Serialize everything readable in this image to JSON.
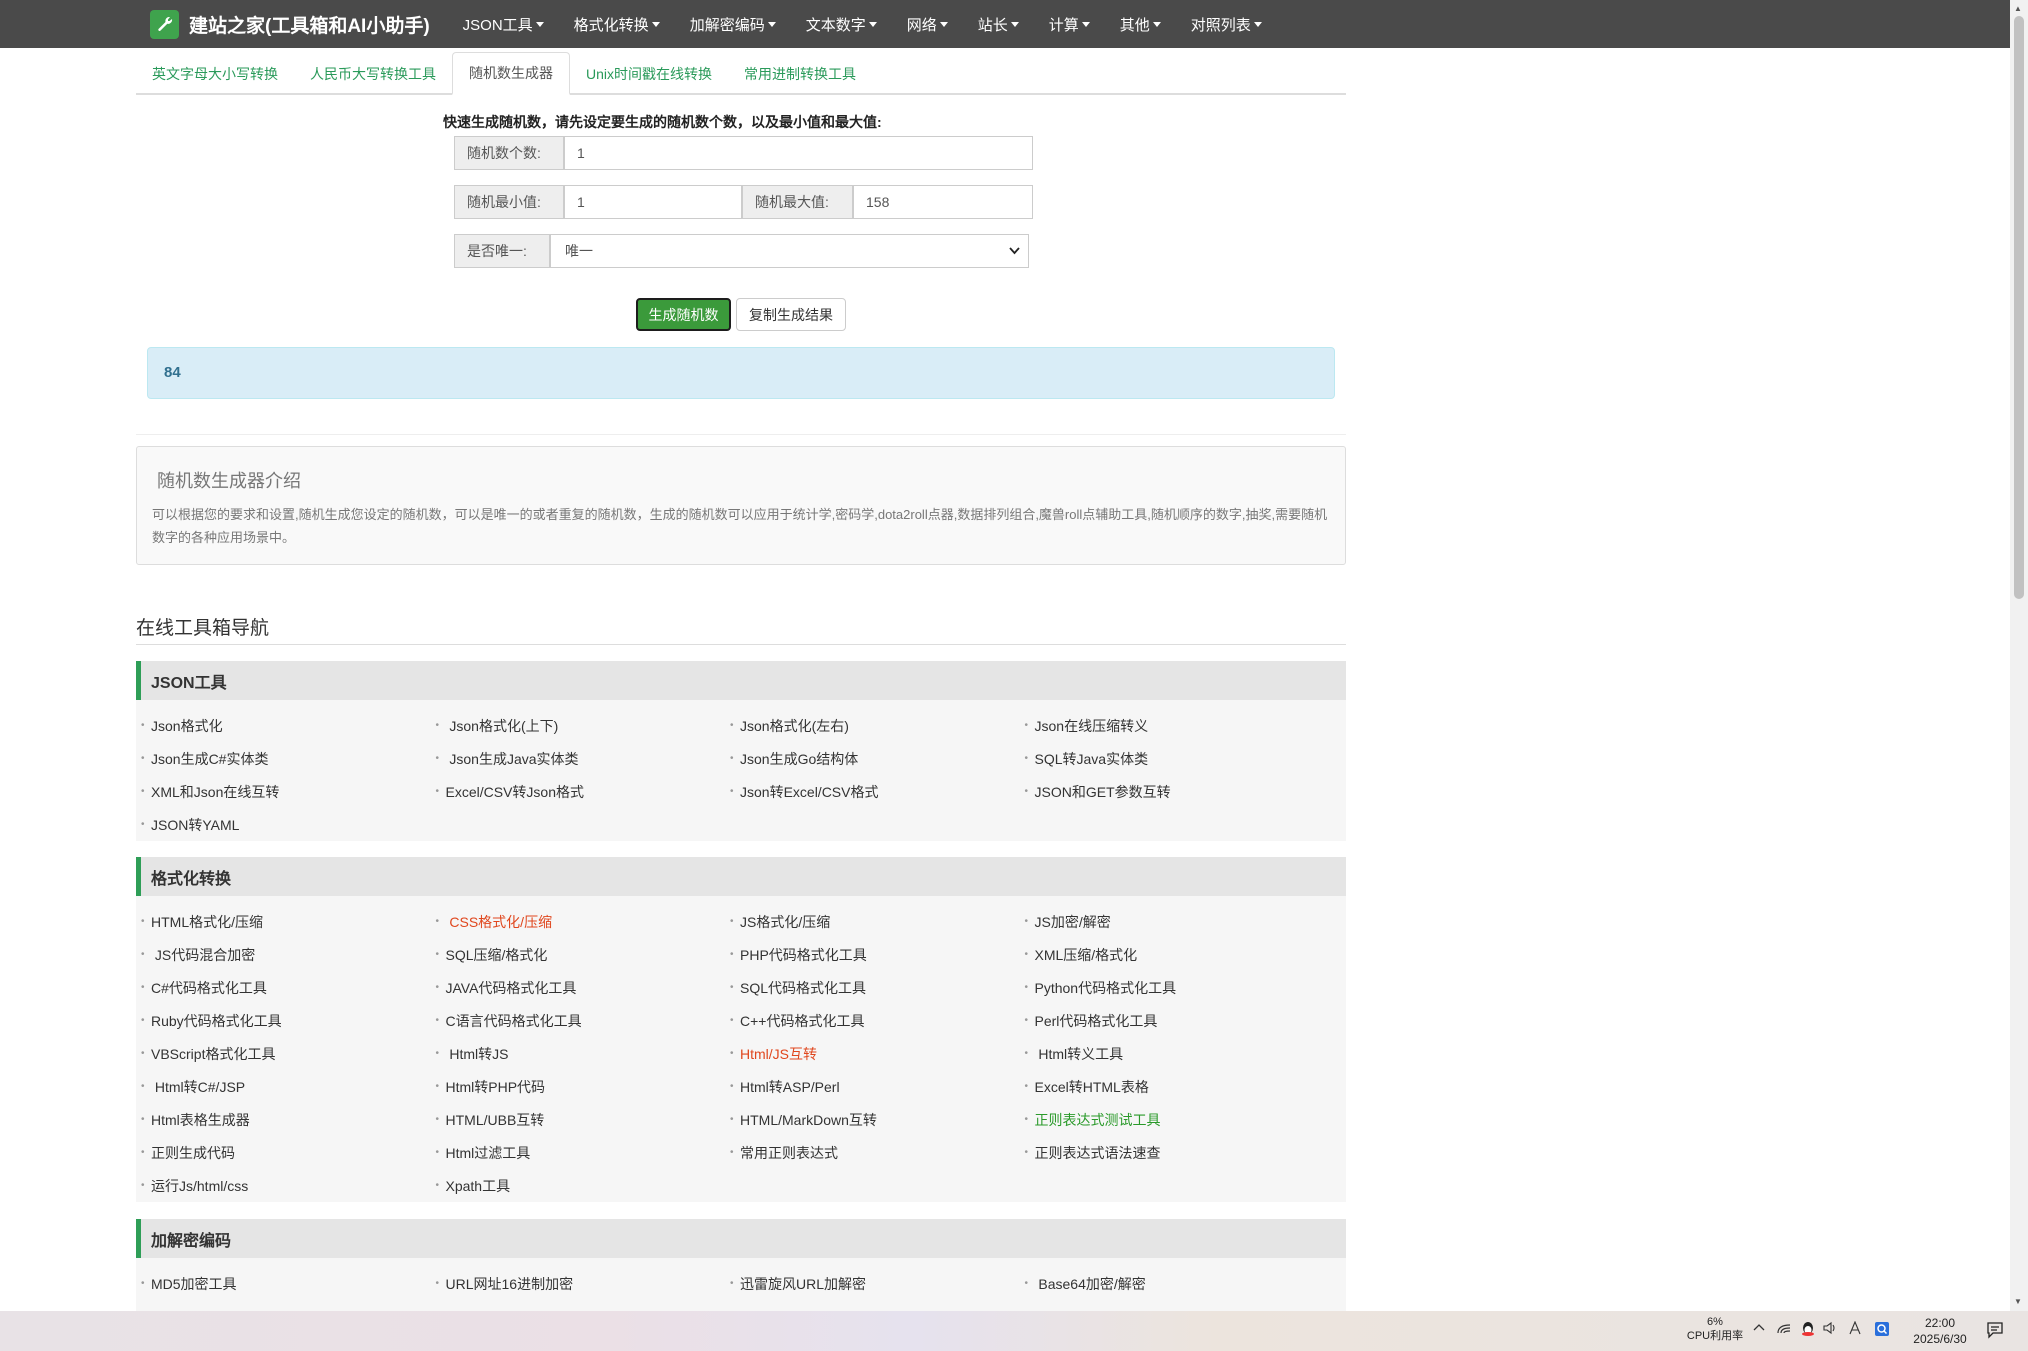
{
  "navbar": {
    "brand": "建站之家(工具箱和AI小助手)",
    "items": [
      "JSON工具",
      "格式化转换",
      "加解密编码",
      "文本数字",
      "网络",
      "站长",
      "计算",
      "其他",
      "对照列表"
    ]
  },
  "tabs": [
    "英文字母大小写转换",
    "人民币大写转换工具",
    "随机数生成器",
    "Unix时间戳在线转换",
    "常用进制转换工具"
  ],
  "form": {
    "instruction": "快速生成随机数，请先设定要生成的随机数个数，以及最小值和最大值:",
    "count_label": "随机数个数:",
    "count_value": "1",
    "min_label": "随机最小值:",
    "min_value": "1",
    "max_label": "随机最大值:",
    "max_value": "158",
    "unique_label": "是否唯一:",
    "unique_value": "唯一",
    "generate_button": "生成随机数",
    "copy_button": "复制生成结果"
  },
  "result": "84",
  "intro": {
    "title": "随机数生成器介绍",
    "text": "可以根据您的要求和设置,随机生成您设定的随机数，可以是唯一的或者重复的随机数，生成的随机数可以应用于统计学,密码学,dota2roll点器,数据排列组合,魔兽roll点辅助工具,随机顺序的数字,抽奖,需要随机数字的各种应用场景中。"
  },
  "nav_heading": "在线工具箱导航",
  "sections": [
    {
      "title": "JSON工具",
      "links": [
        {
          "text": "Json格式化",
          "style": ""
        },
        {
          "text": " Json格式化(上下)",
          "style": ""
        },
        {
          "text": "Json格式化(左右)",
          "style": ""
        },
        {
          "text": "Json在线压缩转义",
          "style": ""
        },
        {
          "text": "Json生成C#实体类",
          "style": ""
        },
        {
          "text": " Json生成Java实体类",
          "style": ""
        },
        {
          "text": "Json生成Go结构体",
          "style": ""
        },
        {
          "text": "SQL转Java实体类",
          "style": ""
        },
        {
          "text": "XML和Json在线互转",
          "style": ""
        },
        {
          "text": "Excel/CSV转Json格式",
          "style": ""
        },
        {
          "text": "Json转Excel/CSV格式",
          "style": ""
        },
        {
          "text": "JSON和GET参数互转",
          "style": ""
        },
        {
          "text": "JSON转YAML",
          "style": ""
        }
      ]
    },
    {
      "title": "格式化转换",
      "links": [
        {
          "text": "HTML格式化/压缩",
          "style": ""
        },
        {
          "text": " CSS格式化/压缩",
          "style": "red"
        },
        {
          "text": "JS格式化/压缩",
          "style": ""
        },
        {
          "text": "JS加密/解密",
          "style": ""
        },
        {
          "text": " JS代码混合加密",
          "style": ""
        },
        {
          "text": "SQL压缩/格式化",
          "style": ""
        },
        {
          "text": "PHP代码格式化工具",
          "style": ""
        },
        {
          "text": "XML压缩/格式化",
          "style": ""
        },
        {
          "text": "C#代码格式化工具",
          "style": ""
        },
        {
          "text": "JAVA代码格式化工具",
          "style": ""
        },
        {
          "text": "SQL代码格式化工具",
          "style": ""
        },
        {
          "text": "Python代码格式化工具",
          "style": ""
        },
        {
          "text": "Ruby代码格式化工具",
          "style": ""
        },
        {
          "text": "C语言代码格式化工具",
          "style": ""
        },
        {
          "text": "C++代码格式化工具",
          "style": ""
        },
        {
          "text": "Perl代码格式化工具",
          "style": ""
        },
        {
          "text": "VBScript格式化工具",
          "style": ""
        },
        {
          "text": " Html转JS",
          "style": ""
        },
        {
          "text": "Html/JS互转",
          "style": "red"
        },
        {
          "text": " Html转义工具",
          "style": ""
        },
        {
          "text": " Html转C#/JSP",
          "style": ""
        },
        {
          "text": "Html转PHP代码",
          "style": ""
        },
        {
          "text": "Html转ASP/Perl",
          "style": ""
        },
        {
          "text": "Excel转HTML表格",
          "style": ""
        },
        {
          "text": "Html表格生成器",
          "style": ""
        },
        {
          "text": "HTML/UBB互转",
          "style": ""
        },
        {
          "text": "HTML/MarkDown互转",
          "style": ""
        },
        {
          "text": "正则表达式测试工具",
          "style": "green"
        },
        {
          "text": "正则生成代码",
          "style": ""
        },
        {
          "text": "Html过滤工具",
          "style": ""
        },
        {
          "text": "常用正则表达式",
          "style": ""
        },
        {
          "text": "正则表达式语法速查",
          "style": ""
        },
        {
          "text": "运行Js/html/css",
          "style": ""
        },
        {
          "text": "Xpath工具",
          "style": ""
        }
      ]
    },
    {
      "title": "加解密编码",
      "links": [
        {
          "text": "MD5加密工具",
          "style": ""
        },
        {
          "text": "URL网址16进制加密",
          "style": ""
        },
        {
          "text": "迅雷旋风URL加解密",
          "style": ""
        },
        {
          "text": " Base64加密/解密",
          "style": ""
        }
      ]
    }
  ],
  "taskbar": {
    "cpu_percent": "6%",
    "cpu_label": "CPU利用率",
    "time": "22:00",
    "date": "2025/6/30"
  },
  "colors": {
    "navbar_bg": "#4a4a4a",
    "accent_green": "#2e9e57",
    "result_bg": "#d9edf7",
    "link_red": "#e0471e"
  }
}
